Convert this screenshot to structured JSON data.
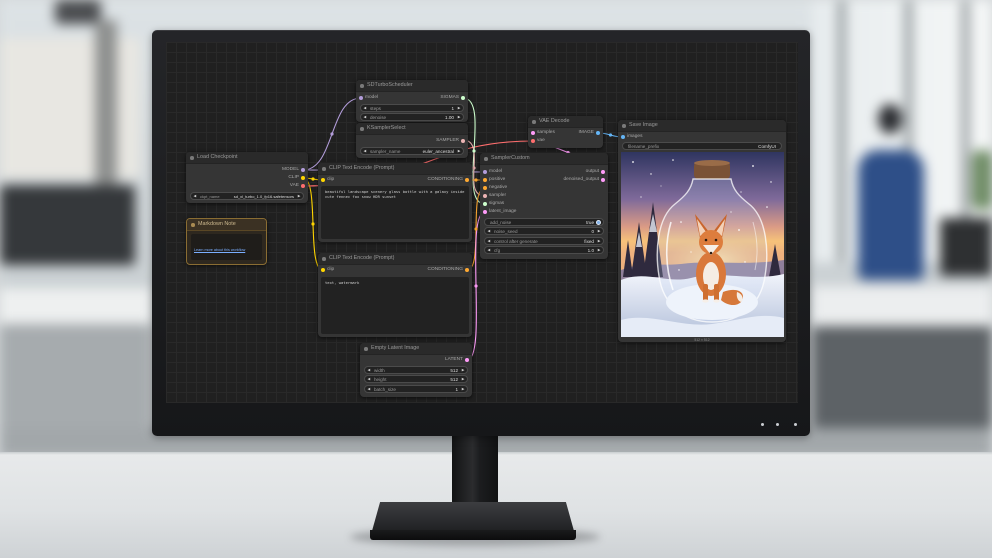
{
  "slot_colors": {
    "model": "#b39ddb",
    "clip": "#ffd500",
    "vae": "#ff6e6e",
    "conditioning": "#ffa931",
    "latent": "#ff9cf9",
    "image": "#64b5f6",
    "sigmas": "#cdffcd",
    "sampler": "#ecb4b4"
  },
  "screen": {
    "nodes": {
      "sd_turbo": {
        "title": "SDTurboScheduler",
        "input": "model",
        "output": "SIGMAS",
        "widgets": [
          {
            "label": "steps",
            "value": "1"
          },
          {
            "label": "denoise",
            "value": "1.00"
          }
        ]
      },
      "ksampler_select": {
        "title": "KSamplerSelect",
        "output": "SAMPLER",
        "widgets": [
          {
            "label": "sampler_name",
            "value": "euler_ancestral"
          }
        ]
      },
      "load_checkpoint": {
        "title": "Load Checkpoint",
        "outputs": [
          "MODEL",
          "CLIP",
          "VAE"
        ],
        "widgets": [
          {
            "label": "ckpt_name",
            "value": "sd_xl_turbo_1.0_fp16.safetensors"
          }
        ]
      },
      "markdown_note": {
        "title": "Markdown Note",
        "link_text": "Learn more about this workflow"
      },
      "clip_positive": {
        "title": "CLIP Text Encode (Prompt)",
        "input": "clip",
        "output": "CONDITIONING",
        "text": "beautiful landscape scenery glass bottle with a galaxy inside cute fennec fox snow HDR sunset"
      },
      "clip_negative": {
        "title": "CLIP Text Encode (Prompt)",
        "input": "clip",
        "output": "CONDITIONING",
        "text": "text, watermark"
      },
      "empty_latent": {
        "title": "Empty Latent Image",
        "output": "LATENT",
        "widgets": [
          {
            "label": "width",
            "value": "512"
          },
          {
            "label": "height",
            "value": "512"
          },
          {
            "label": "batch_size",
            "value": "1"
          }
        ]
      },
      "vae_decode": {
        "title": "VAE Decode",
        "inputs": [
          "samples",
          "vae"
        ],
        "output": "IMAGE"
      },
      "sampler_custom": {
        "title": "SamplerCustom",
        "inputs": [
          "model",
          "positive",
          "negative",
          "sampler",
          "sigmas",
          "latent_image"
        ],
        "outputs": [
          "output",
          "denoised_output"
        ],
        "widgets": [
          {
            "label": "add_noise",
            "value": "true"
          },
          {
            "label": "noise_seed",
            "value": "0"
          },
          {
            "label": "control after generate",
            "value": "fixed"
          },
          {
            "label": "cfg",
            "value": "1.0"
          }
        ]
      },
      "save_image": {
        "title": "Save Image",
        "input": "images",
        "widgets": [
          {
            "label": "filename_prefix",
            "value": "ComfyUI"
          }
        ],
        "image_caption": "512 × 512"
      }
    }
  }
}
